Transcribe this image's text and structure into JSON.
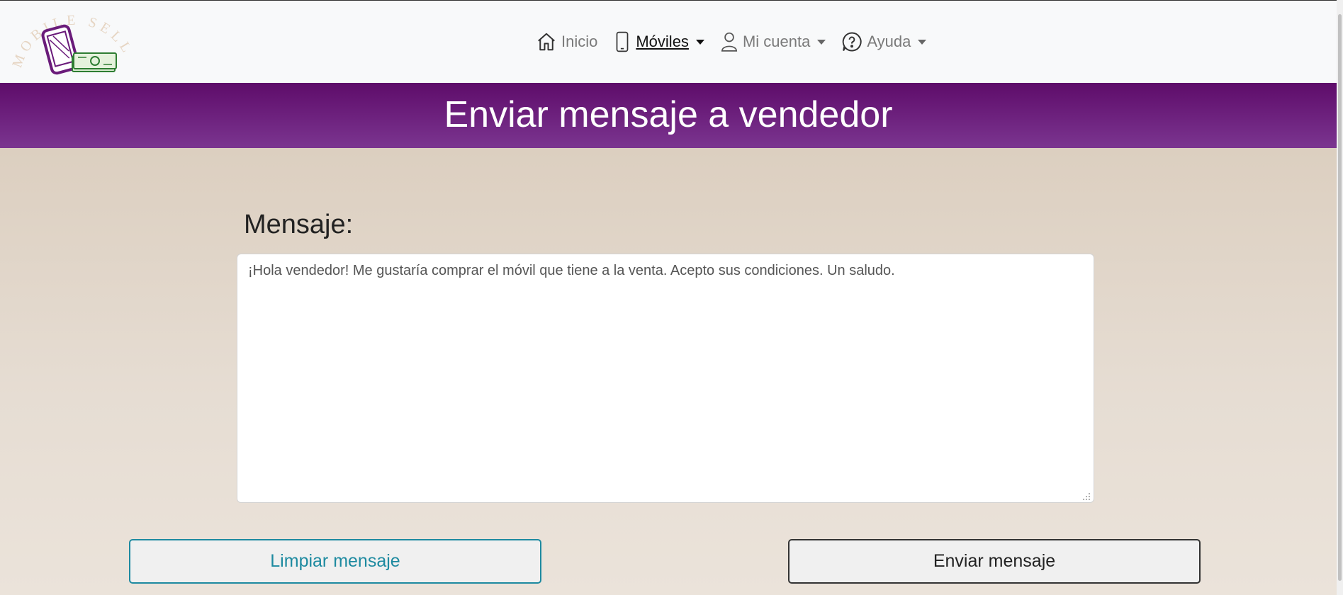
{
  "logo": {
    "text": "MOBILE SELL",
    "colors": {
      "phone": "#6a1b7a",
      "money": "#2e7d32",
      "text": "#e6d5c3"
    }
  },
  "nav": {
    "items": [
      {
        "label": "Inicio",
        "icon": "home-icon",
        "dropdown": false,
        "active": false
      },
      {
        "label": "Móviles",
        "icon": "phone-icon",
        "dropdown": true,
        "active": true
      },
      {
        "label": "Mi cuenta",
        "icon": "user-icon",
        "dropdown": true,
        "active": false
      },
      {
        "label": "Ayuda",
        "icon": "help-icon",
        "dropdown": true,
        "active": false
      }
    ]
  },
  "banner": {
    "title": "Enviar mensaje a vendedor",
    "color": "#6b1f7c"
  },
  "form": {
    "label": "Mensaje:",
    "message": "¡Hola vendedor! Me gustaría comprar el móvil que tiene a la venta. Acepto sus condiciones. Un saludo.",
    "clear_label": "Limpiar mensaje",
    "send_label": "Enviar mensaje"
  },
  "colors": {
    "accent": "#1d8aa0",
    "background": "#dccfc0",
    "navbar": "#f8f9fa"
  }
}
